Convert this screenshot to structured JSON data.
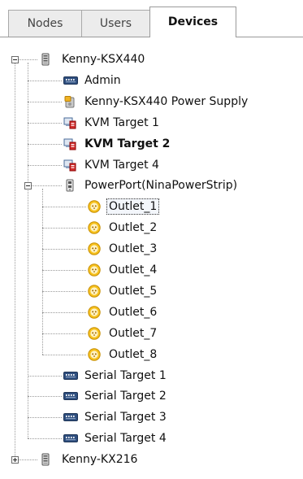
{
  "tabs": [
    {
      "label": "Nodes",
      "active": false
    },
    {
      "label": "Users",
      "active": false
    },
    {
      "label": "Devices",
      "active": true
    }
  ],
  "tree": {
    "nodes": [
      {
        "label": "Kenny-KSX440",
        "icon": "device-chassis-icon",
        "level": 0,
        "expander": "minus"
      },
      {
        "label": "Admin",
        "icon": "port-connector-icon",
        "level": 1
      },
      {
        "label": "Kenny-KSX440  Power Supply",
        "icon": "power-supply-icon",
        "level": 1
      },
      {
        "label": "KVM Target 1",
        "icon": "kvm-target-icon",
        "level": 1
      },
      {
        "label": "KVM Target 2",
        "icon": "kvm-target-icon",
        "level": 1,
        "bold": true
      },
      {
        "label": "KVM Target 4",
        "icon": "kvm-target-icon",
        "level": 1
      },
      {
        "label": "PowerPort(NinaPowerStrip)",
        "icon": "power-strip-icon",
        "level": 1,
        "expander": "minus"
      },
      {
        "label": "Outlet_1",
        "icon": "outlet-icon",
        "level": 2,
        "selected": true
      },
      {
        "label": "Outlet_2",
        "icon": "outlet-icon",
        "level": 2
      },
      {
        "label": "Outlet_3",
        "icon": "outlet-icon",
        "level": 2
      },
      {
        "label": "Outlet_4",
        "icon": "outlet-icon",
        "level": 2
      },
      {
        "label": "Outlet_5",
        "icon": "outlet-icon",
        "level": 2
      },
      {
        "label": "Outlet_6",
        "icon": "outlet-icon",
        "level": 2
      },
      {
        "label": "Outlet_7",
        "icon": "outlet-icon",
        "level": 2
      },
      {
        "label": "Outlet_8",
        "icon": "outlet-icon",
        "level": 2
      },
      {
        "label": "Serial Target 1",
        "icon": "port-connector-icon",
        "level": 1
      },
      {
        "label": "Serial Target 2",
        "icon": "port-connector-icon",
        "level": 1
      },
      {
        "label": "Serial Target 3",
        "icon": "port-connector-icon",
        "level": 1
      },
      {
        "label": "Serial Target 4",
        "icon": "port-connector-icon",
        "level": 1
      },
      {
        "label": "Kenny-KX216",
        "icon": "device-chassis-icon",
        "level": 0,
        "expander": "plus"
      }
    ]
  }
}
